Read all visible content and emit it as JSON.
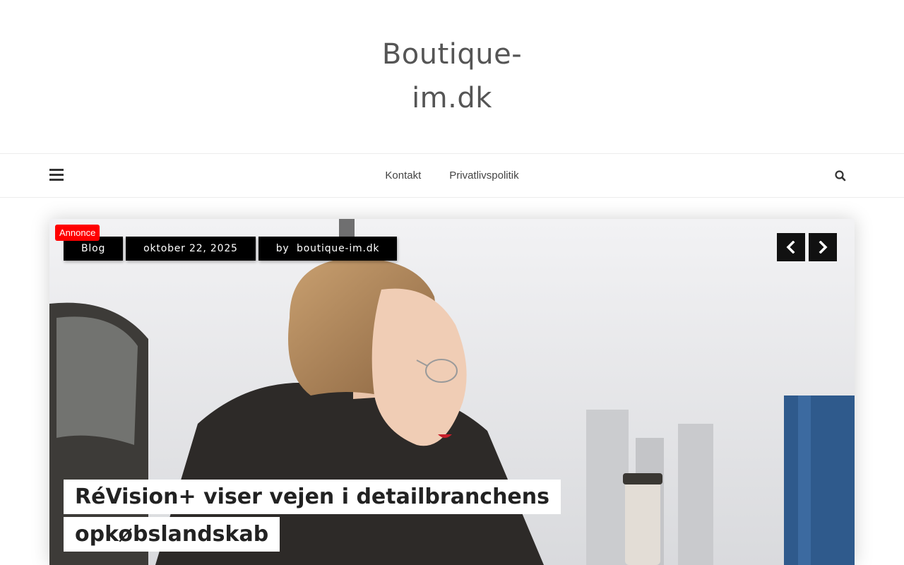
{
  "site": {
    "title": "Boutique-im.dk",
    "title_line1": "Boutique-",
    "title_line2": "im.dk"
  },
  "nav": {
    "items": [
      {
        "label": "Kontakt"
      },
      {
        "label": "Privatlivspolitik"
      }
    ],
    "menu_icon": "hamburger-icon",
    "search_icon": "search-icon"
  },
  "slider": {
    "ad_badge": "Annonce",
    "category": "Blog",
    "date": "oktober 22, 2025",
    "by_label": "by",
    "author": "boutique-im.dk",
    "title": "RéVision+ viser vejen i detailbranchens opkøbslandskab",
    "prev_icon": "chevron-left-icon",
    "next_icon": "chevron-right-icon"
  },
  "colors": {
    "ad_badge": "#ff0000",
    "chip_bg": "#000000",
    "text": "#555555"
  }
}
